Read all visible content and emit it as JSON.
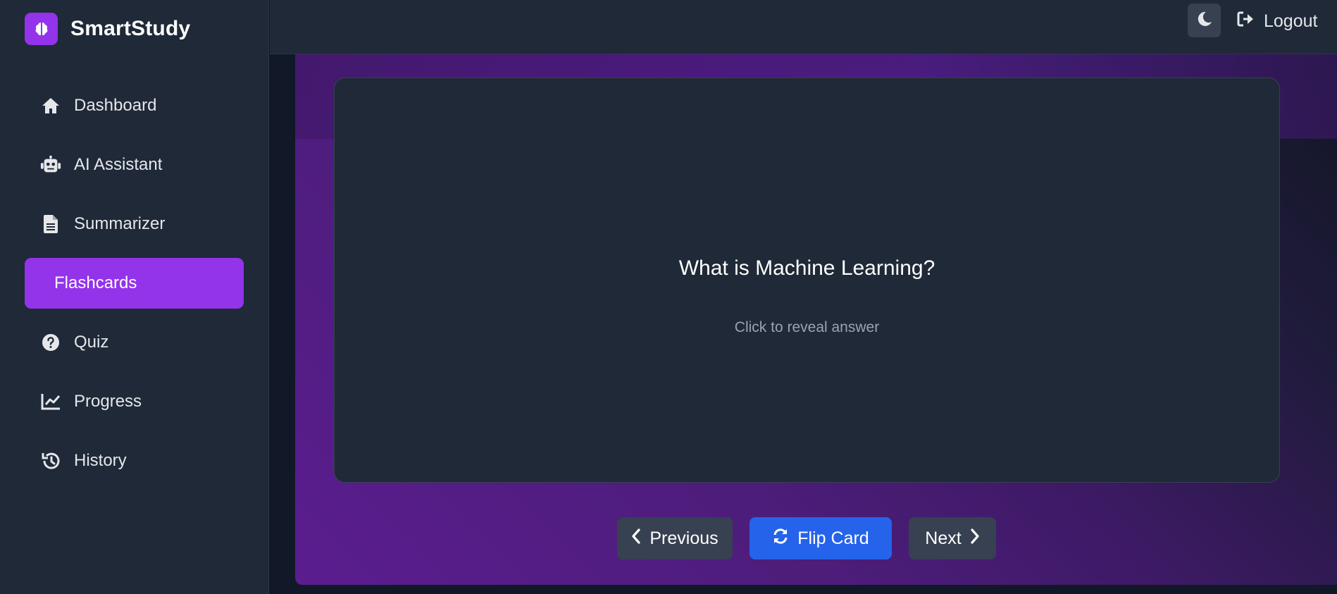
{
  "app": {
    "name": "SmartStudy"
  },
  "sidebar": {
    "items": [
      {
        "label": "Dashboard",
        "icon": "home-icon"
      },
      {
        "label": "AI Assistant",
        "icon": "robot-icon"
      },
      {
        "label": "Summarizer",
        "icon": "document-icon"
      },
      {
        "label": "Flashcards",
        "icon": "",
        "active": true
      },
      {
        "label": "Quiz",
        "icon": "question-circle-icon"
      },
      {
        "label": "Progress",
        "icon": "chart-line-icon"
      },
      {
        "label": "History",
        "icon": "history-icon"
      }
    ]
  },
  "topbar": {
    "theme_toggle_icon": "moon-icon",
    "logout_label": "Logout"
  },
  "flashcard": {
    "question": "What is Machine Learning?",
    "hint": "Click to reveal answer"
  },
  "controls": {
    "previous_label": "Previous",
    "flip_label": "Flip Card",
    "next_label": "Next"
  },
  "colors": {
    "accent": "#9333ea",
    "primary_button": "#2563eb",
    "sidebar_bg": "#1f2937",
    "card_bg": "#1f2937"
  }
}
